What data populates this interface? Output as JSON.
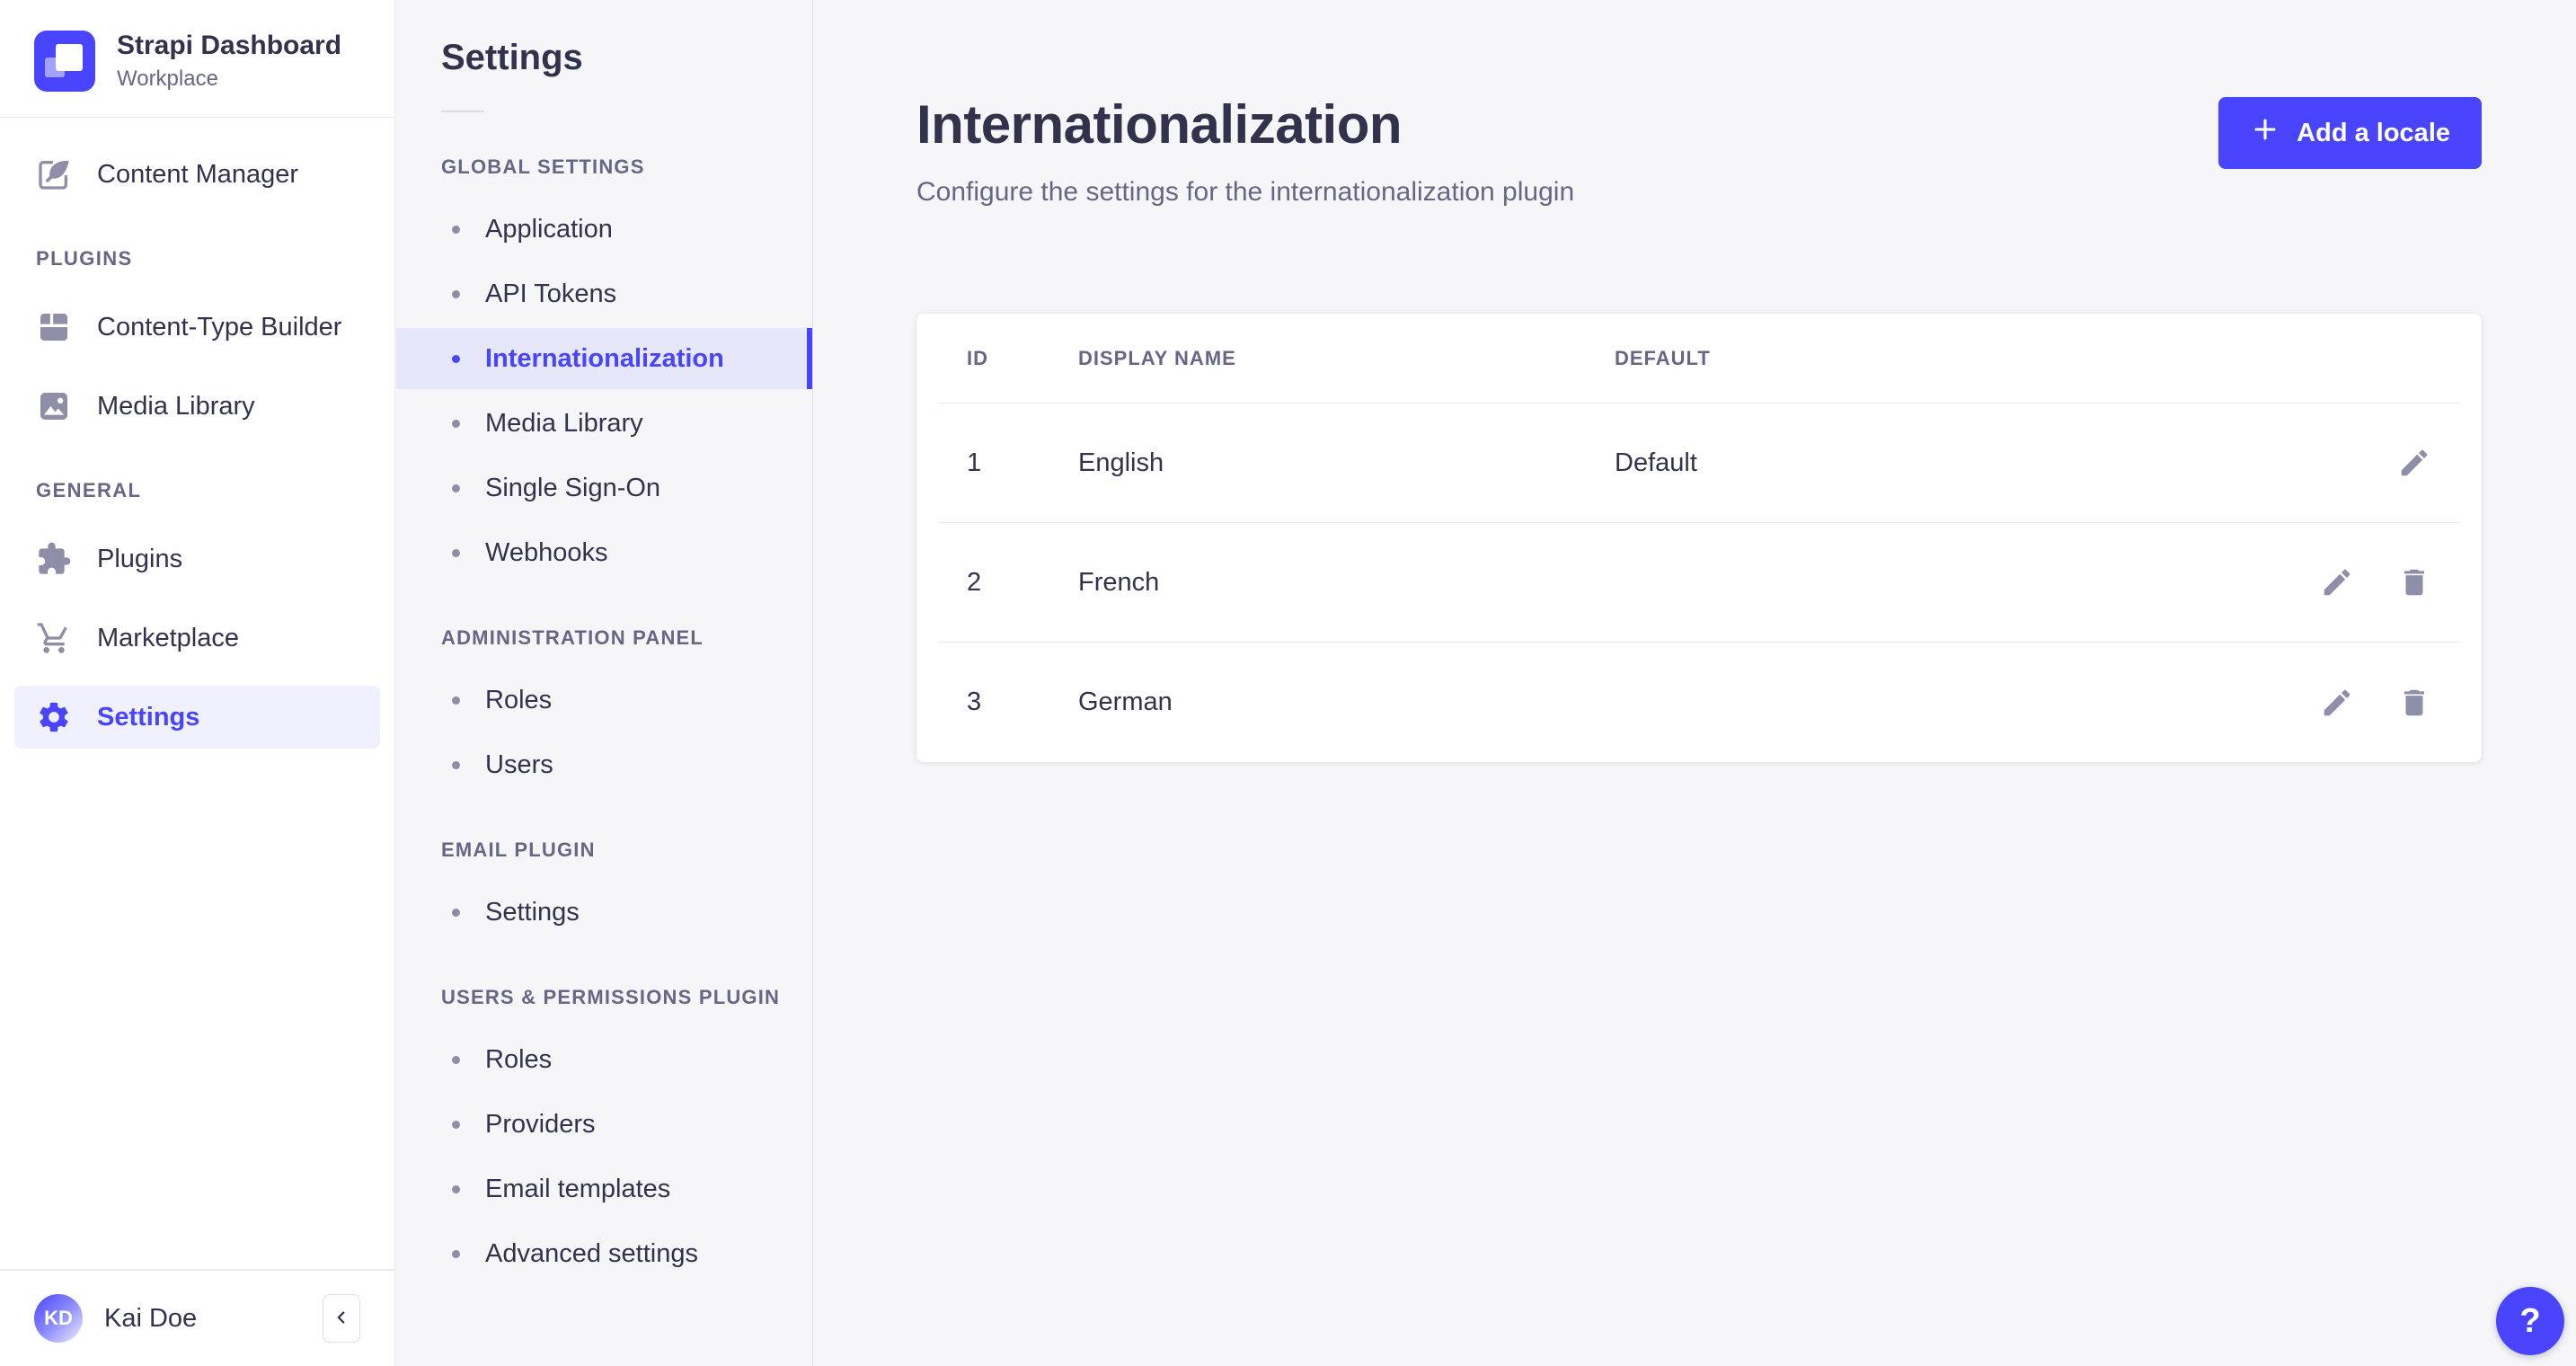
{
  "app": {
    "name": "Strapi Dashboard",
    "workspace": "Workplace",
    "user": {
      "name": "Kai Doe",
      "initials": "KD"
    }
  },
  "colors": {
    "primary": "#4945ff",
    "selected_bg_sidebar": "#f0f0ff",
    "selected_bg_subnav": "#e7e7fb",
    "text_dark": "#32324d",
    "text_muted": "#666687",
    "icon_muted": "#8e8ea9",
    "page_bg": "#f6f6f9"
  },
  "sidebar": {
    "top_items": [
      {
        "label": "Content Manager",
        "icon": "content-manager-icon",
        "selected": false
      }
    ],
    "sections": [
      {
        "label": "PLUGINS",
        "items": [
          {
            "label": "Content-Type Builder",
            "icon": "content-type-builder-icon",
            "selected": false
          },
          {
            "label": "Media Library",
            "icon": "media-library-icon",
            "selected": false
          }
        ]
      },
      {
        "label": "GENERAL",
        "items": [
          {
            "label": "Plugins",
            "icon": "plugins-icon",
            "selected": false
          },
          {
            "label": "Marketplace",
            "icon": "marketplace-icon",
            "selected": false
          },
          {
            "label": "Settings",
            "icon": "settings-icon",
            "selected": true
          }
        ]
      }
    ]
  },
  "subnav": {
    "title": "Settings",
    "sections": [
      {
        "label": "GLOBAL SETTINGS",
        "items": [
          "Application",
          "API Tokens",
          "Internationalization",
          "Media Library",
          "Single Sign-On",
          "Webhooks"
        ],
        "selected": "Internationalization"
      },
      {
        "label": "ADMINISTRATION PANEL",
        "items": [
          "Roles",
          "Users"
        ],
        "selected": ""
      },
      {
        "label": "EMAIL PLUGIN",
        "items": [
          "Settings"
        ],
        "selected": ""
      },
      {
        "label": "USERS & PERMISSIONS PLUGIN",
        "items": [
          "Roles",
          "Providers",
          "Email templates",
          "Advanced settings"
        ],
        "selected": ""
      }
    ]
  },
  "main": {
    "title": "Internationalization",
    "subtitle": "Configure the settings for the internationalization plugin",
    "add_button_label": "Add a locale",
    "table": {
      "columns": [
        "ID",
        "DISPLAY NAME",
        "DEFAULT"
      ],
      "rows": [
        {
          "id": "1",
          "display_name": "English",
          "default": "Default",
          "actions": [
            "edit"
          ]
        },
        {
          "id": "2",
          "display_name": "French",
          "default": "",
          "actions": [
            "edit",
            "delete"
          ]
        },
        {
          "id": "3",
          "display_name": "German",
          "default": "",
          "actions": [
            "edit",
            "delete"
          ]
        }
      ]
    }
  },
  "help": {
    "label": "?"
  }
}
